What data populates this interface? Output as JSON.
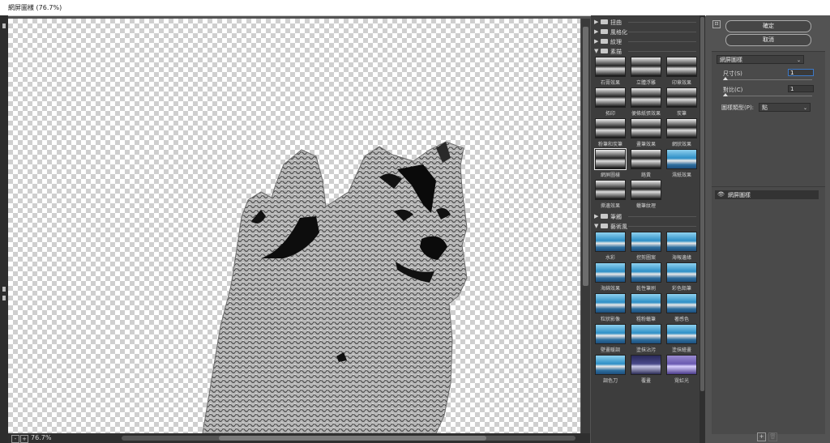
{
  "window": {
    "title": "網屏圖樣 (76.7%)"
  },
  "canvas": {
    "zoom": "76.7%",
    "zoom_out": "-",
    "zoom_in": "+"
  },
  "gallery": {
    "categories_top": [
      {
        "label": "扭曲",
        "expanded": false
      },
      {
        "label": "風格化",
        "expanded": false
      },
      {
        "label": "紋理",
        "expanded": false
      },
      {
        "label": "素描",
        "expanded": true
      }
    ],
    "sketch_filters": [
      {
        "label": "石膏效果",
        "style": "bw"
      },
      {
        "label": "立體浮雕",
        "style": "bw"
      },
      {
        "label": "印章效果",
        "style": "bw"
      },
      {
        "label": "拓印",
        "style": "bw"
      },
      {
        "label": "便條紙張效果",
        "style": "bw"
      },
      {
        "label": "炭筆",
        "style": "bw"
      },
      {
        "label": "粉筆和炭筆",
        "style": "bw"
      },
      {
        "label": "畫筆效果",
        "style": "bw"
      },
      {
        "label": "網狀效果",
        "style": "bw"
      },
      {
        "label": "網屏圖樣",
        "style": "bw",
        "selected": true
      },
      {
        "label": "鉻黃",
        "style": "bw"
      },
      {
        "label": "濕紙效果",
        "style": "col"
      },
      {
        "label": "撕邊效果",
        "style": "bw"
      },
      {
        "label": "蠟筆紋理",
        "style": "bw"
      }
    ],
    "categories_mid": [
      {
        "label": "筆觸",
        "expanded": false
      },
      {
        "label": "藝術風",
        "expanded": true
      }
    ],
    "artistic_filters": [
      {
        "label": "水彩",
        "style": "col"
      },
      {
        "label": "挖剪圖案",
        "style": "col"
      },
      {
        "label": "海報邊緣",
        "style": "col"
      },
      {
        "label": "海綿效果",
        "style": "col"
      },
      {
        "label": "乾性筆刷",
        "style": "col"
      },
      {
        "label": "彩色鉛筆",
        "style": "col"
      },
      {
        "label": "粒狀影像",
        "style": "col"
      },
      {
        "label": "粗粉蠟筆",
        "style": "col"
      },
      {
        "label": "著感色",
        "style": "col"
      },
      {
        "label": "壁畫暖調",
        "style": "col"
      },
      {
        "label": "塗抹沾污",
        "style": "col"
      },
      {
        "label": "塗抹繪畫",
        "style": "col"
      },
      {
        "label": "調色刀",
        "style": "col"
      },
      {
        "label": "覆畫",
        "style": "dark"
      },
      {
        "label": "霓虹光",
        "style": "violet"
      }
    ]
  },
  "panel": {
    "ok_label": "確定",
    "cancel_label": "取消",
    "collapse_icon": "⊡",
    "filter_select": "網屏圖樣",
    "size_label": "尺寸(S)",
    "size_value": "1",
    "contrast_label": "對比(C)",
    "contrast_value": "1",
    "pattern_type_label": "圖樣類型(P):",
    "pattern_type_value": "點",
    "layer_name": "網屏圖樣",
    "new_layer_icon": "+",
    "delete_layer_icon": "🗑"
  }
}
